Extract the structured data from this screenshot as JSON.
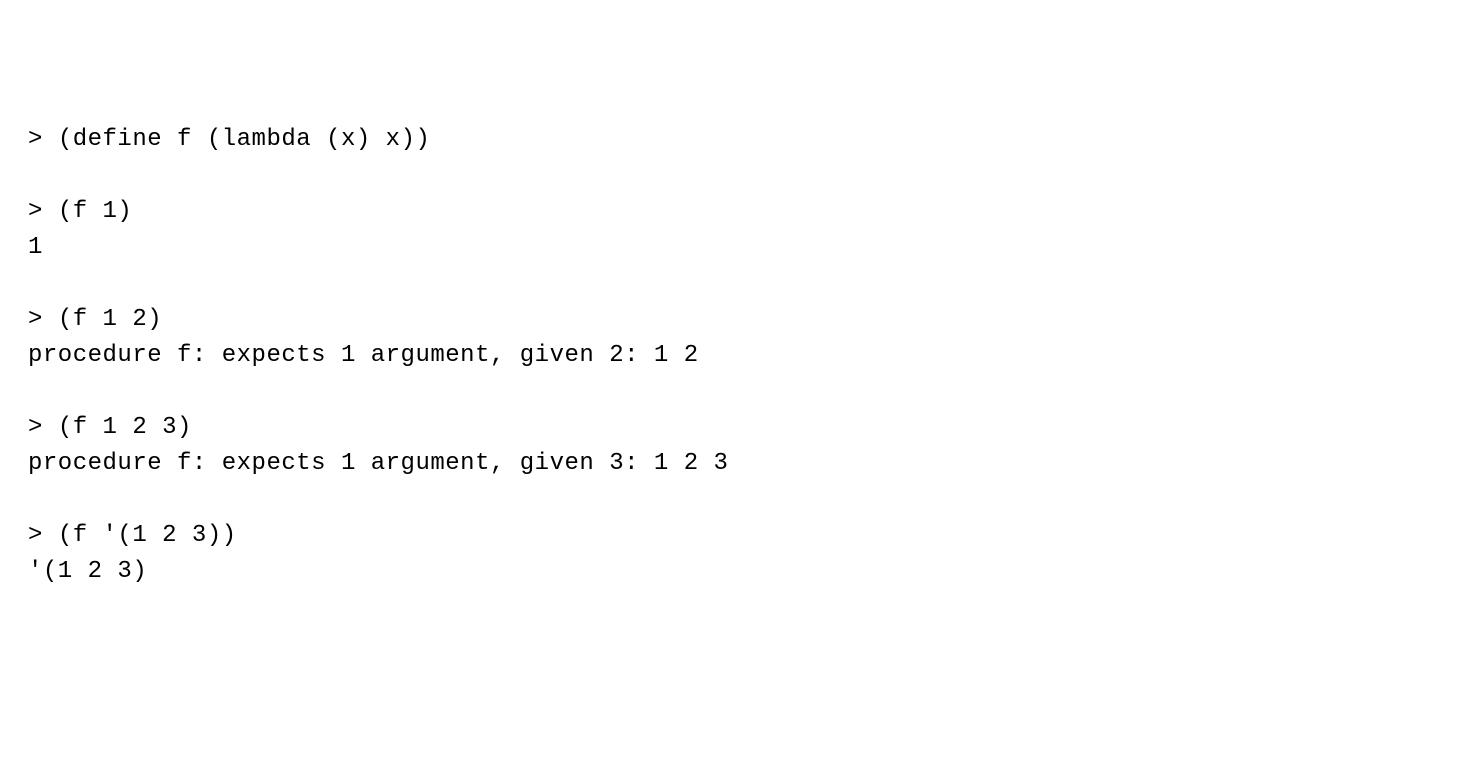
{
  "repl": {
    "prompt": ">",
    "entries": [
      {
        "input": "(define f (lambda (x) x))",
        "outputs": []
      },
      {
        "input": "(f 1)",
        "outputs": [
          "1"
        ]
      },
      {
        "input": "(f 1 2)",
        "outputs": [
          "procedure f: expects 1 argument, given 2: 1 2"
        ]
      },
      {
        "input": "(f 1 2 3)",
        "outputs": [
          "procedure f: expects 1 argument, given 3: 1 2 3"
        ]
      },
      {
        "input": "(f '(1 2 3))",
        "outputs": [
          "'(1 2 3)"
        ]
      }
    ]
  }
}
